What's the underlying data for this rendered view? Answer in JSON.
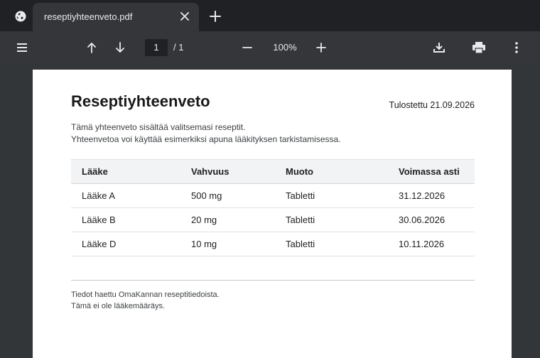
{
  "browser": {
    "tab": {
      "title": "reseptiyhteenveto.pdf"
    },
    "icons": {
      "favicon": "globe-icon",
      "close": "close-icon",
      "new_tab": "plus-icon"
    }
  },
  "pdf_toolbar": {
    "current_page": "1",
    "page_total": "/ 1",
    "zoom": "100%",
    "icons": [
      "menu-icon",
      "arrow-up-icon",
      "arrow-down-icon",
      "minus-icon",
      "plus-icon",
      "download-icon",
      "print-icon",
      "more-vert-icon"
    ]
  },
  "document": {
    "title": "Reseptiyhteenveto",
    "printed_date": "Tulostettu 21.09.2026",
    "intro_line1": "Tämä yhteenveto sisältää valitsemasi reseptit.",
    "intro_line2": "Yhteenvetoa voi käyttää esimerkiksi apuna lääkityksen tarkistamisessa.",
    "table": {
      "headers": [
        "Lääke",
        "Vahvuus",
        "Muoto",
        "Voimassa asti"
      ],
      "rows": [
        [
          "Lääke A",
          "500 mg",
          "Tabletti",
          "31.12.2026"
        ],
        [
          "Lääke B",
          "20 mg",
          "Tabletti",
          "30.06.2026"
        ],
        [
          "Lääke D",
          "10 mg",
          "Tabletti",
          "10.11.2026"
        ]
      ]
    },
    "footnote_line1": "Tiedot haettu OmaKannan reseptitiedoista.",
    "footnote_line2": "Tämä ei ole lääkemääräys."
  }
}
